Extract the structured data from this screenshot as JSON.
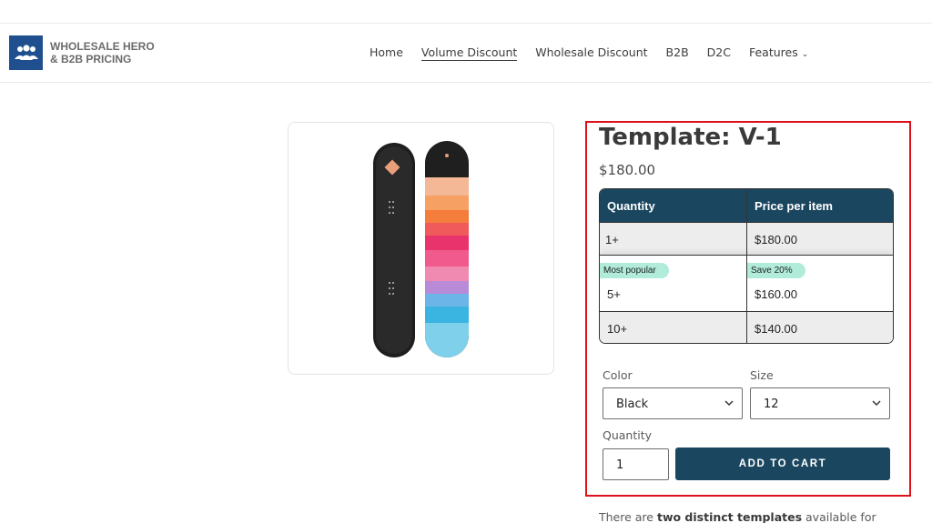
{
  "header": {
    "logo_line1": "WHOLESALE HERO",
    "logo_line2": "& B2B PRICING",
    "nav": [
      "Home",
      "Volume Discount",
      "Wholesale Discount",
      "B2B",
      "D2C",
      "Features"
    ],
    "active_nav": "Volume Discount"
  },
  "product": {
    "title": "Template: V-1",
    "price": "$180.00",
    "image_alt": "snowboard-pair"
  },
  "pricing_table": {
    "headers": [
      "Quantity",
      "Price per item"
    ],
    "rows": [
      {
        "quantity": "1+",
        "price": "$180.00",
        "badge_left": "",
        "badge_right": ""
      },
      {
        "quantity": "5+",
        "price": "$160.00",
        "badge_left": "Most popular",
        "badge_right": "Save 20%"
      },
      {
        "quantity": "10+",
        "price": "$140.00",
        "badge_left": "",
        "badge_right": ""
      }
    ]
  },
  "options": {
    "color_label": "Color",
    "color_value": "Black",
    "size_label": "Size",
    "size_value": "12",
    "quantity_label": "Quantity",
    "quantity_value": "1"
  },
  "actions": {
    "add_to_cart": "ADD TO CART"
  },
  "description": {
    "prefix": "There are ",
    "bold": "two distinct templates",
    "suffix": " available for"
  },
  "colors": {
    "accent": "#1a4660",
    "logo_bg": "#1f4f8f",
    "highlight": "#e0101a",
    "badge": "#b0ecd9"
  },
  "icons": [
    "people-group-icon",
    "chevron-down-icon"
  ]
}
